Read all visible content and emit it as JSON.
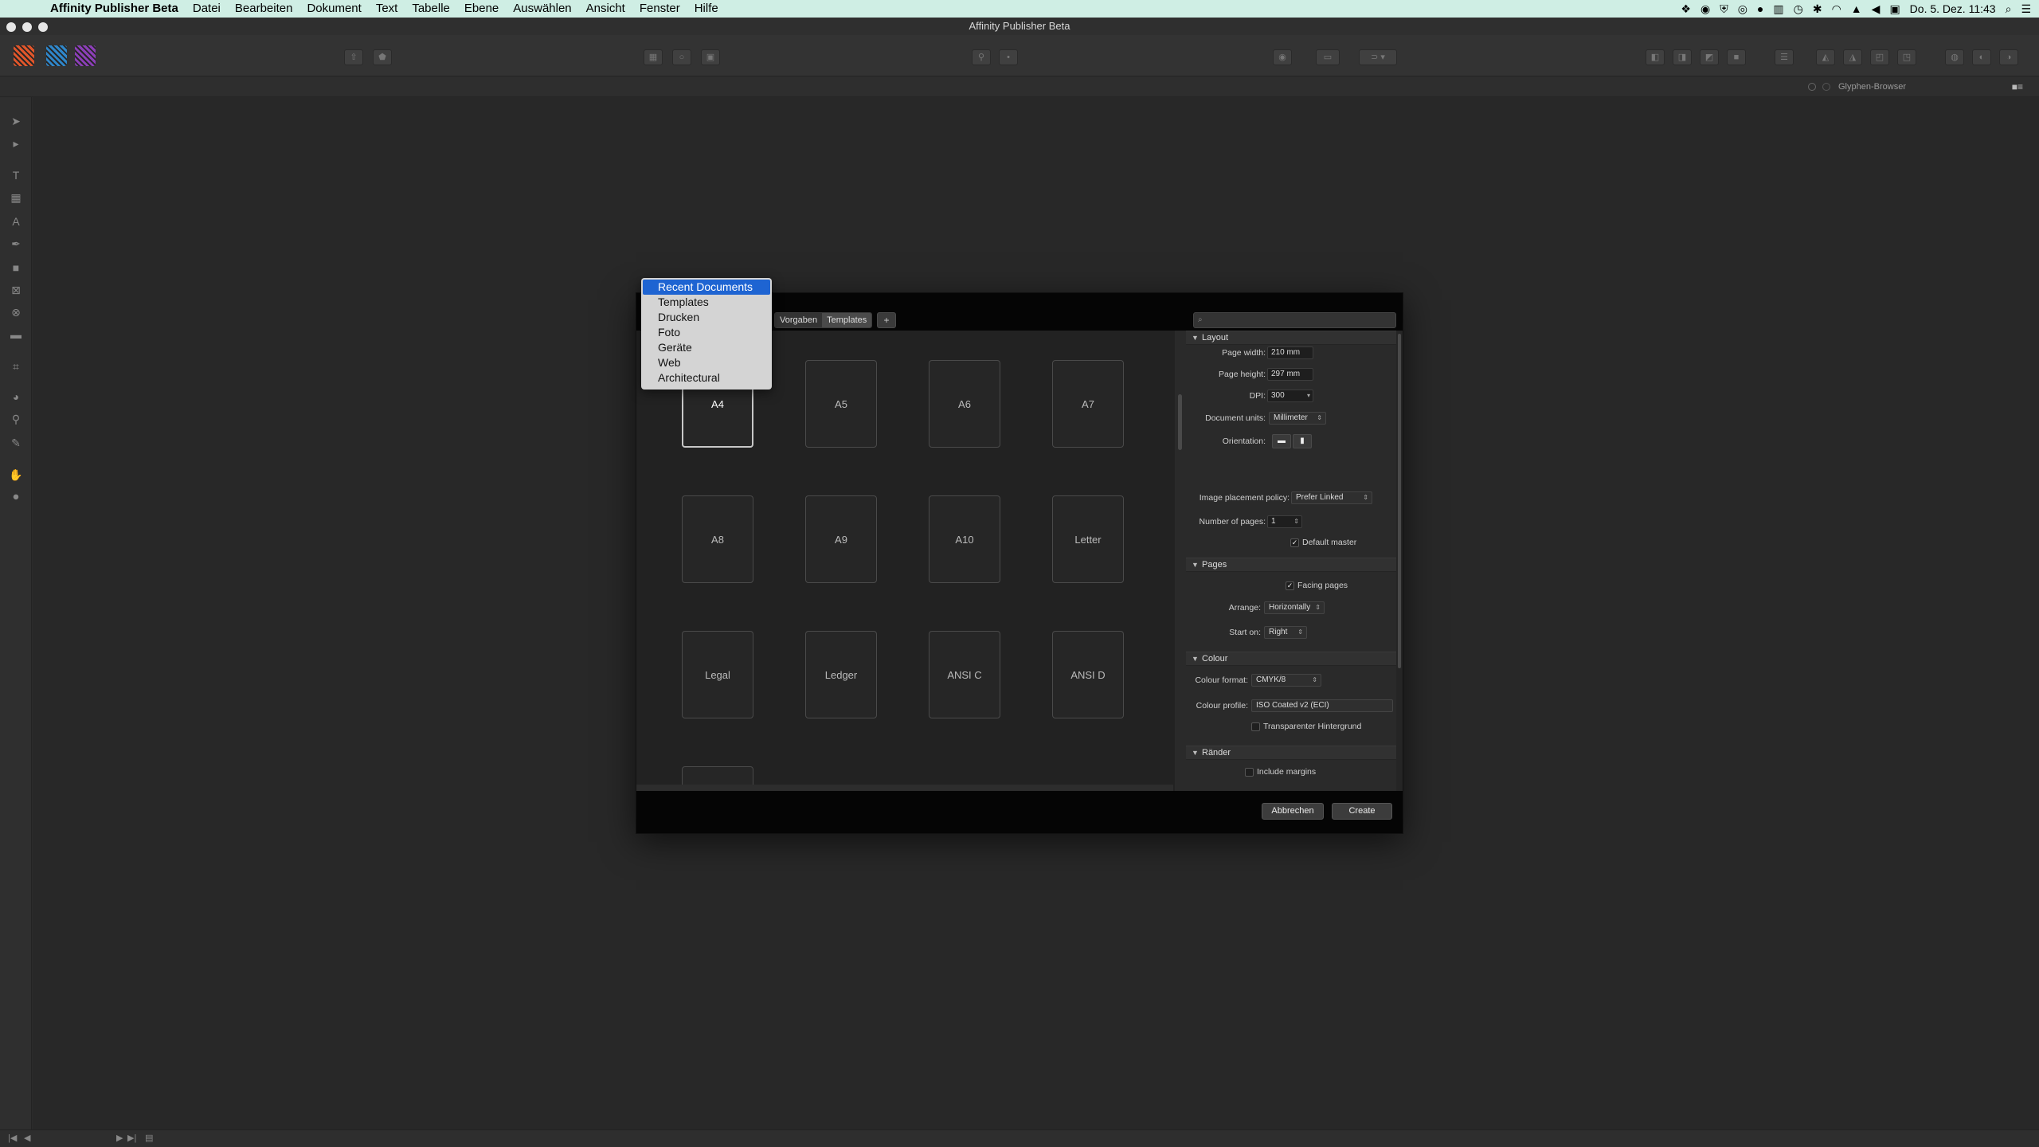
{
  "menubar": {
    "apple_glyph": "",
    "app_name": "Affinity Publisher Beta",
    "items": [
      "Datei",
      "Bearbeiten",
      "Dokument",
      "Text",
      "Tabelle",
      "Ebene",
      "Auswählen",
      "Ansicht",
      "Fenster",
      "Hilfe"
    ],
    "clock": "Do. 5. Dez.  11:43"
  },
  "window": {
    "title": "Affinity Publisher Beta"
  },
  "personas": {
    "colors": [
      "#e0562b",
      "#2f86c9",
      "#8b3fb7"
    ]
  },
  "context": {
    "panel_tab": "Glyphen-Browser"
  },
  "dialog": {
    "tabs": [
      "Vorgaben",
      "Templates"
    ],
    "add_tab": "+",
    "search_placeholder": "",
    "presets": [
      "A4",
      "A5",
      "A6",
      "A7",
      "A8",
      "A9",
      "A10",
      "Letter",
      "Legal",
      "Ledger",
      "ANSI C",
      "ANSI D",
      ""
    ],
    "selected_preset": "A4",
    "layout": {
      "title": "Layout",
      "page_width_label": "Page width:",
      "page_width": "210 mm",
      "page_height_label": "Page height:",
      "page_height": "297 mm",
      "dpi_label": "DPI:",
      "dpi": "300",
      "units_label": "Document units:",
      "units": "Millimeter",
      "orientation_label": "Orientation:",
      "image_policy_label": "Image placement policy:",
      "image_policy": "Prefer Linked",
      "num_pages_label": "Number of pages:",
      "num_pages": "1",
      "default_master_label": "Default master"
    },
    "pages": {
      "title": "Pages",
      "facing_label": "Facing pages",
      "arrange_label": "Arrange:",
      "arrange": "Horizontally",
      "start_label": "Start on:",
      "start": "Right"
    },
    "colour": {
      "title": "Colour",
      "format_label": "Colour format:",
      "format": "CMYK/8",
      "profile_label": "Colour profile:",
      "profile": "ISO Coated v2 (ECI)",
      "transparent_label": "Transparenter Hintergrund"
    },
    "margins": {
      "title": "Ränder",
      "include_label": "Include margins"
    },
    "cancel": "Abbrechen",
    "create": "Create"
  },
  "dropdown": {
    "items": [
      "Recent Documents",
      "Templates",
      "Drucken",
      "Foto",
      "Geräte",
      "Web",
      "Architectural"
    ],
    "selected": "Recent Documents"
  }
}
